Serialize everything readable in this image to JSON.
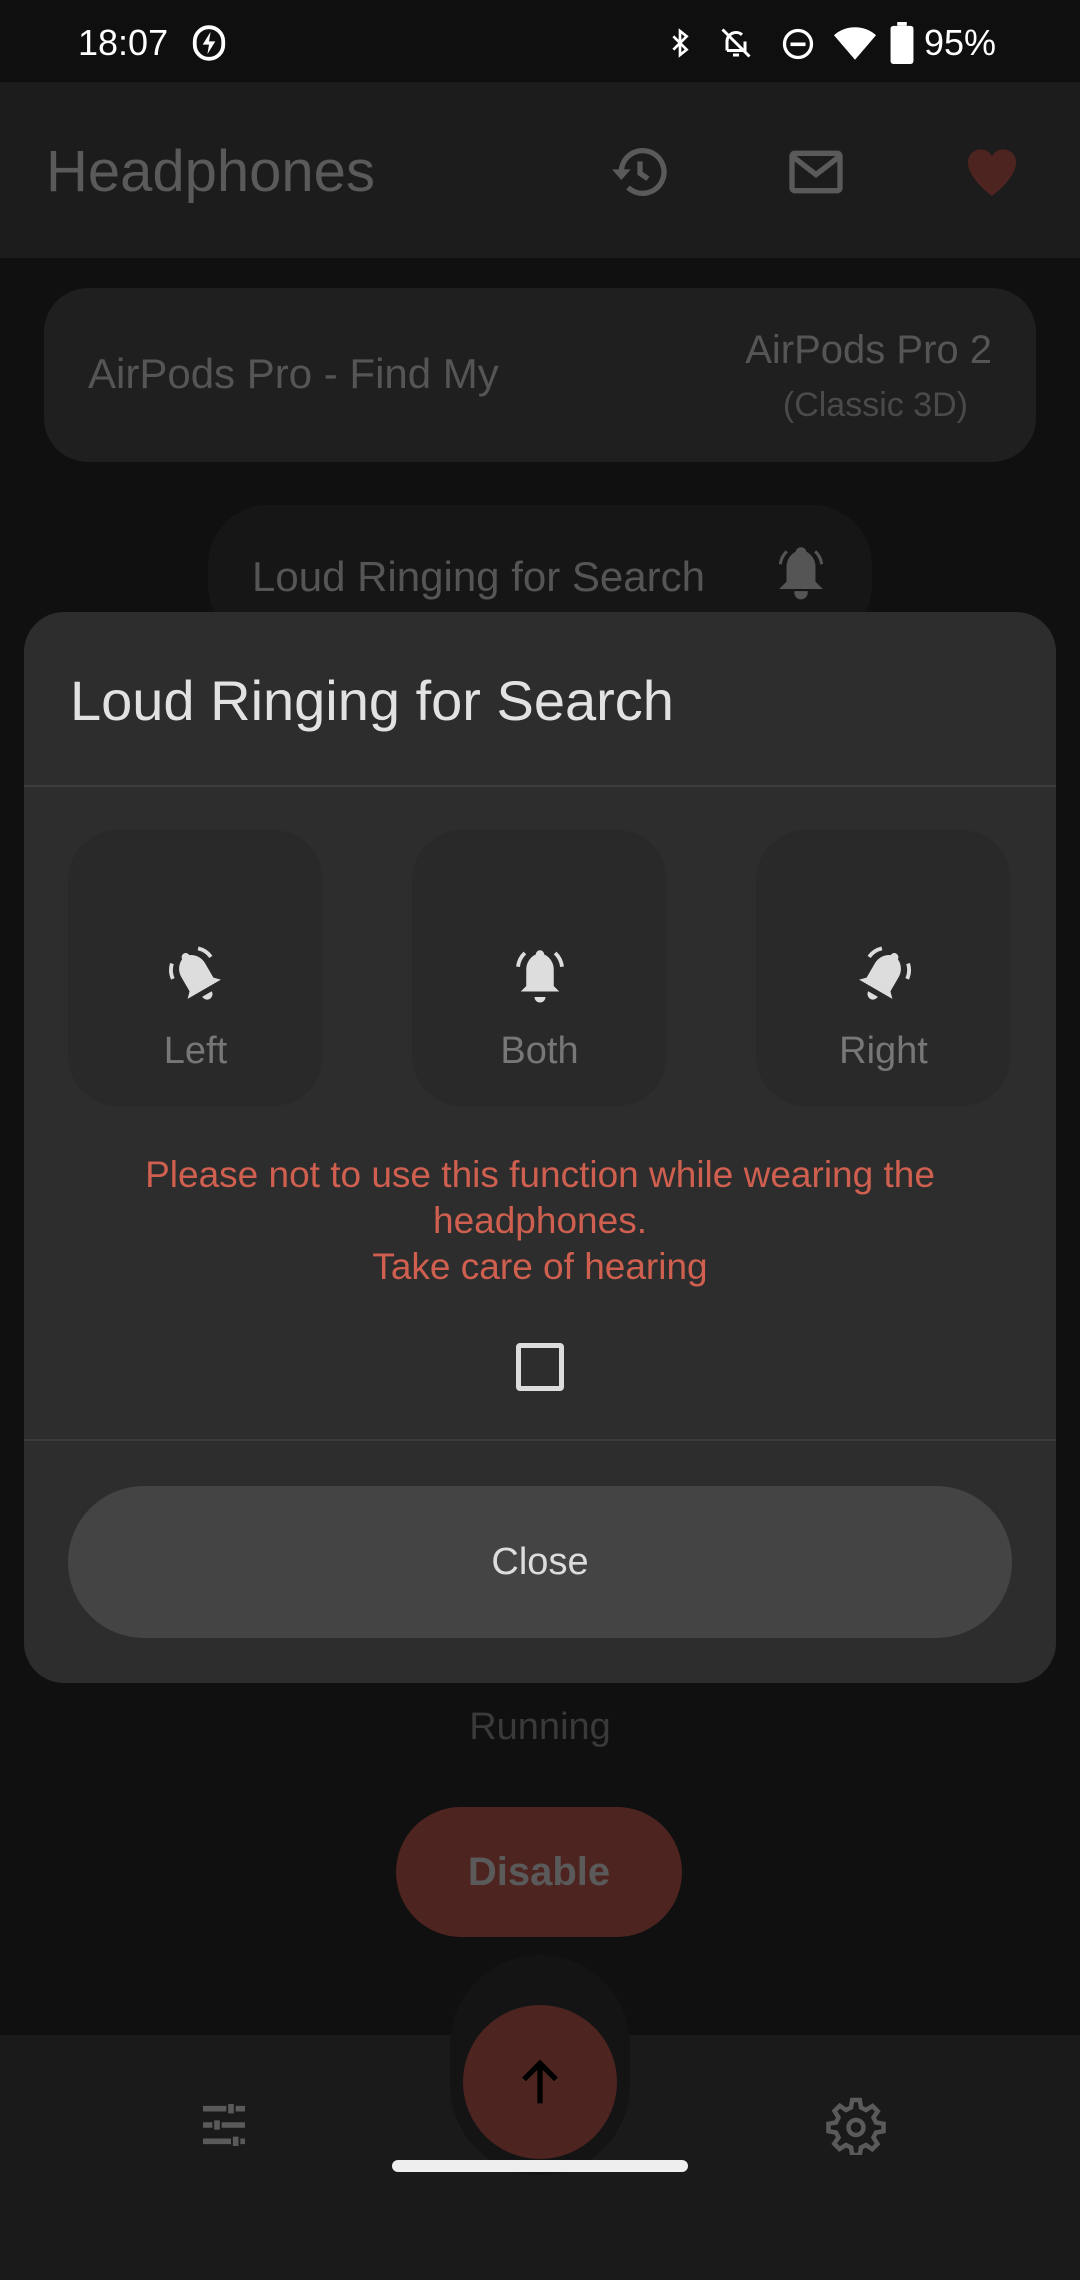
{
  "status_bar": {
    "time": "18:07",
    "battery": "95%",
    "icons": [
      "charging-icon",
      "bluetooth-icon",
      "notifications-off-icon",
      "do-not-disturb-icon",
      "wifi-icon",
      "battery-icon"
    ]
  },
  "app_bar": {
    "title": "Headphones",
    "actions": [
      "history-icon",
      "mail-icon",
      "heart-icon"
    ]
  },
  "device_card": {
    "name": "AirPods Pro - Find My",
    "model": "AirPods Pro 2",
    "variant": "(Classic 3D)"
  },
  "feature_pill": {
    "label": "Loud Ringing for Search"
  },
  "dialog": {
    "title": "Loud Ringing for Search",
    "options": [
      {
        "label": "Left"
      },
      {
        "label": "Both"
      },
      {
        "label": "Right"
      }
    ],
    "warning_line1": "Please not to use this function while wearing the headphones.",
    "warning_line2": "Take care of hearing",
    "checkbox_checked": false,
    "close_label": "Close"
  },
  "service": {
    "status": "Running",
    "button_label": "Disable"
  },
  "colors": {
    "accent": "#4e2420",
    "warning": "#cf5f4f",
    "heart": "#4e2420"
  }
}
